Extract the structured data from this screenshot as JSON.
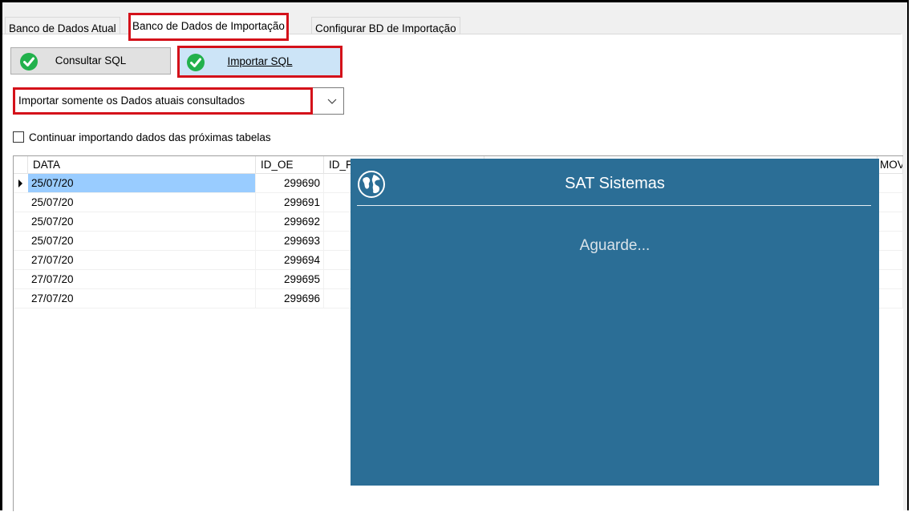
{
  "tabs": [
    {
      "label": "Banco de Dados Atual"
    },
    {
      "label": "Banco de Dados de Importação",
      "active": true
    },
    {
      "label": "Configurar BD de Importação"
    }
  ],
  "toolbar": {
    "consult_label": "Consultar SQL",
    "import_label": "Importar SQL"
  },
  "combo": {
    "selected": "Importar somente os Dados atuais consultados"
  },
  "checkbox": {
    "label": "Continuar importando dados das próximas tabelas",
    "checked": false
  },
  "grid": {
    "columns": [
      "DATA",
      "ID_OE",
      "ID_F",
      "MOV"
    ],
    "rows": [
      {
        "data": "25/07/20",
        "id_oe": "299690",
        "selected": true
      },
      {
        "data": "25/07/20",
        "id_oe": "299691"
      },
      {
        "data": "25/07/20",
        "id_oe": "299692"
      },
      {
        "data": "25/07/20",
        "id_oe": "299693"
      },
      {
        "data": "27/07/20",
        "id_oe": "299694"
      },
      {
        "data": "27/07/20",
        "id_oe": "299695"
      },
      {
        "data": "27/07/20",
        "id_oe": "299696"
      }
    ]
  },
  "dialog": {
    "title": "SAT Sistemas",
    "message": "Aguarde...",
    "icon": "globe-icon"
  },
  "colors": {
    "highlight": "#d4111a",
    "dialog_bg": "#2b6e96",
    "selection": "#99ccff",
    "check_green": "#22b14c"
  }
}
